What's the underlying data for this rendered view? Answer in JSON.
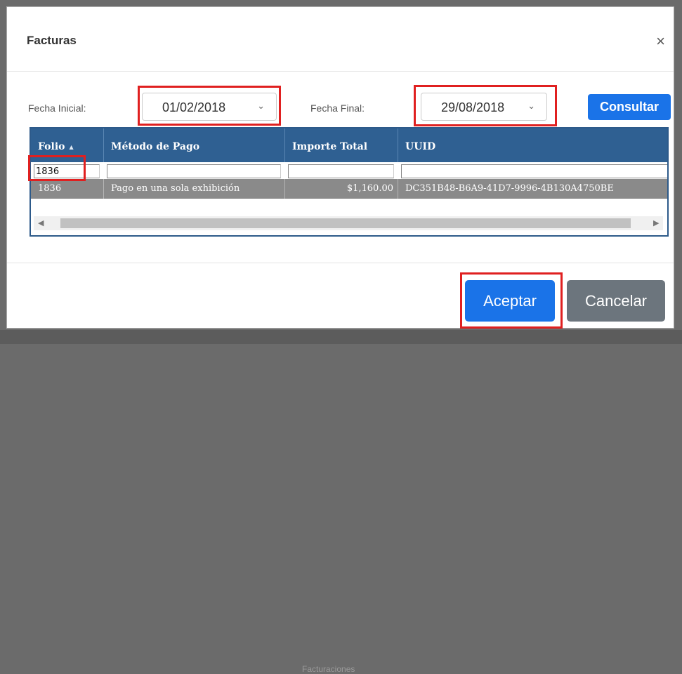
{
  "dialog": {
    "title": "Facturas",
    "close_symbol": "×"
  },
  "filters": {
    "start_label": "Fecha Inicial:",
    "start_value": "01/02/2018",
    "end_label": "Fecha Final:",
    "end_value": "29/08/2018",
    "consult_label": "Consultar"
  },
  "grid": {
    "columns": [
      {
        "label": "Folio",
        "sort": "▲"
      },
      {
        "label": "Método de Pago"
      },
      {
        "label": "Importe Total"
      },
      {
        "label": "UUID"
      }
    ],
    "filter_values": [
      "1836",
      "",
      "",
      ""
    ],
    "rows": [
      [
        "1836",
        "Pago en una sola exhibición",
        "$1,160.00",
        "DC351B48-B6A9-41D7-9996-4B130A4750BE"
      ]
    ]
  },
  "footer": {
    "accept_label": "Aceptar",
    "cancel_label": "Cancelar"
  },
  "background": {
    "partial_text": "Facturaciones"
  },
  "colors": {
    "primary": "#1a73e8",
    "secondary": "#6c757d",
    "grid_header": "#2f6092",
    "highlight": "#e02020"
  }
}
